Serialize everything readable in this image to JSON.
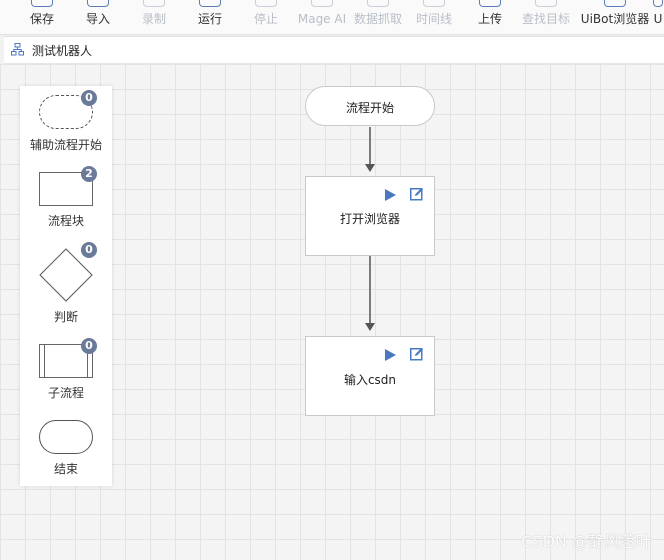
{
  "toolbar": {
    "items": [
      {
        "label": "保存",
        "icon": "save-icon",
        "enabled": true
      },
      {
        "label": "导入",
        "icon": "import-icon",
        "enabled": true
      },
      {
        "label": "录制",
        "icon": "record-icon",
        "enabled": false
      },
      {
        "label": "运行",
        "icon": "run-icon",
        "enabled": true
      },
      {
        "label": "停止",
        "icon": "stop-icon",
        "enabled": false
      },
      {
        "label": "Mage AI",
        "icon": "mage-ai-icon",
        "enabled": false
      },
      {
        "label": "数据抓取",
        "icon": "data-capture-icon",
        "enabled": false
      },
      {
        "label": "时间线",
        "icon": "timeline-icon",
        "enabled": false
      },
      {
        "label": "上传",
        "icon": "upload-icon",
        "enabled": true
      },
      {
        "label": "查找目标",
        "icon": "find-target-icon",
        "enabled": false
      },
      {
        "label": "UiBot浏览器",
        "icon": "uibot-browser-icon",
        "enabled": true
      },
      {
        "label": "U",
        "icon": "more-icon",
        "enabled": true
      }
    ]
  },
  "tab": {
    "title": "测试机器人",
    "icon": "flowchart-icon"
  },
  "palette": {
    "items": [
      {
        "label": "辅助流程开始",
        "count": "0",
        "shape": "rounded-dashed"
      },
      {
        "label": "流程块",
        "count": "2",
        "shape": "rectangle"
      },
      {
        "label": "判断",
        "count": "0",
        "shape": "diamond"
      },
      {
        "label": "子流程",
        "count": "0",
        "shape": "subprocess"
      },
      {
        "label": "结束",
        "count": null,
        "shape": "pill"
      }
    ]
  },
  "flow": {
    "start": {
      "label": "流程开始"
    },
    "blocks": [
      {
        "label": "打开浏览器"
      },
      {
        "label": "输入csdn"
      }
    ]
  },
  "colors": {
    "accent": "#4a78c2",
    "badge": "#6b7a99",
    "disabled_text": "#b9bec7"
  },
  "watermark": "CSDN @静风落叶"
}
